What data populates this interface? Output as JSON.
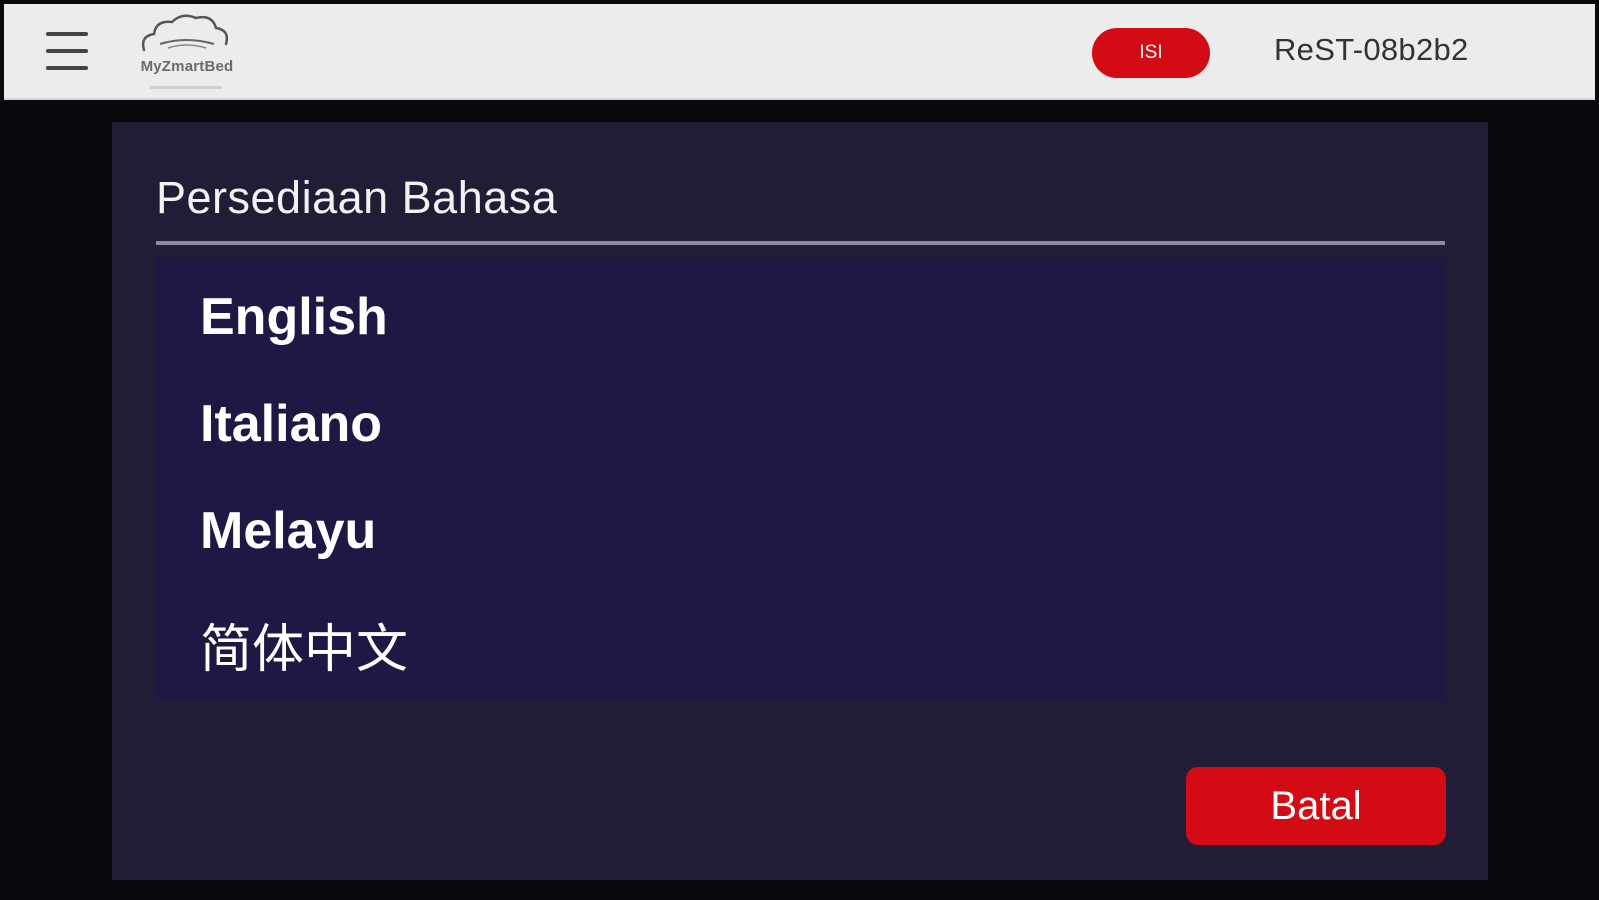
{
  "topbar": {
    "logo_text": "MyZmartBed",
    "isi_label": "ISI",
    "device_id": "ReST-08b2b2"
  },
  "dialog": {
    "title": "Persediaan Bahasa",
    "languages": [
      {
        "label": "English"
      },
      {
        "label": "Italiano"
      },
      {
        "label": "Melayu"
      },
      {
        "label": "简体中文"
      }
    ],
    "cancel_label": "Batal"
  },
  "colors": {
    "accent_red": "#d30b14",
    "dialog_bg": "#221c37",
    "list_bg": "#1f1744",
    "topbar_bg": "#ececec"
  }
}
